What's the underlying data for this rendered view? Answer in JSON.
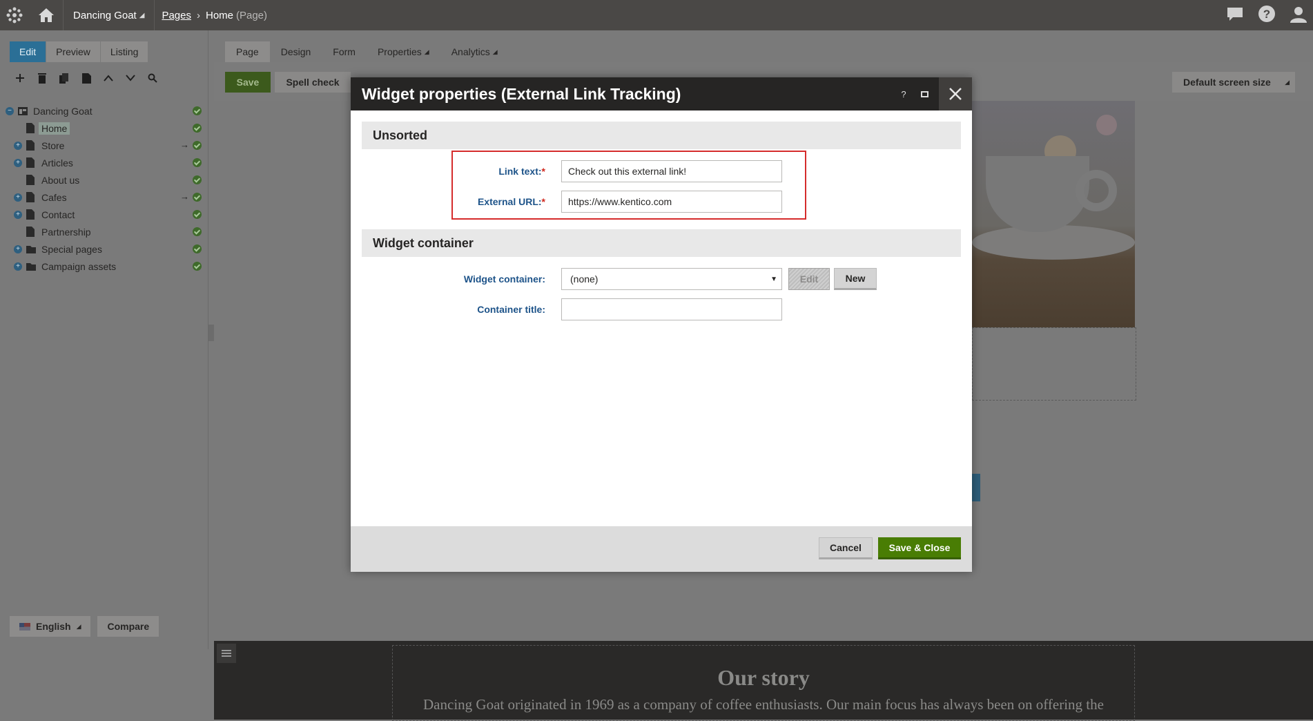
{
  "topbar": {
    "site_name": "Dancing Goat",
    "breadcrumb": {
      "root": "Pages",
      "current": "Home",
      "type": "(Page)"
    },
    "icons": [
      "kentico-logo-icon",
      "home-icon",
      "chat-icon",
      "help-icon",
      "user-icon"
    ]
  },
  "left": {
    "mode_tabs": [
      {
        "label": "Edit",
        "active": true
      },
      {
        "label": "Preview",
        "active": false
      },
      {
        "label": "Listing",
        "active": false
      }
    ],
    "tree": [
      {
        "label": "Dancing Goat",
        "expander": "minus",
        "icon": "site-icon",
        "level": 0,
        "selected": false,
        "arrow": false
      },
      {
        "label": "Home",
        "expander": "",
        "icon": "page-icon",
        "level": 1,
        "selected": true,
        "arrow": false
      },
      {
        "label": "Store",
        "expander": "plus",
        "icon": "page-icon",
        "level": 1,
        "selected": false,
        "arrow": true
      },
      {
        "label": "Articles",
        "expander": "plus",
        "icon": "page-icon",
        "level": 1,
        "selected": false,
        "arrow": false
      },
      {
        "label": "About us",
        "expander": "",
        "icon": "page-icon",
        "level": 1,
        "selected": false,
        "arrow": false
      },
      {
        "label": "Cafes",
        "expander": "plus",
        "icon": "page-icon",
        "level": 1,
        "selected": false,
        "arrow": true
      },
      {
        "label": "Contact",
        "expander": "plus",
        "icon": "page-icon",
        "level": 1,
        "selected": false,
        "arrow": false
      },
      {
        "label": "Partnership",
        "expander": "",
        "icon": "page-icon",
        "level": 1,
        "selected": false,
        "arrow": false
      },
      {
        "label": "Special pages",
        "expander": "plus",
        "icon": "folder-icon",
        "level": 1,
        "selected": false,
        "arrow": false
      },
      {
        "label": "Campaign assets",
        "expander": "plus",
        "icon": "folder-icon",
        "level": 1,
        "selected": false,
        "arrow": false
      }
    ],
    "language": "English",
    "compare": "Compare"
  },
  "content": {
    "tabs": [
      {
        "label": "Page",
        "active": true,
        "caret": false
      },
      {
        "label": "Design",
        "active": false,
        "caret": false
      },
      {
        "label": "Form",
        "active": false,
        "caret": false
      },
      {
        "label": "Properties",
        "active": false,
        "caret": true
      },
      {
        "label": "Analytics",
        "active": false,
        "caret": true
      }
    ],
    "save": "Save",
    "spell_check": "Spell check",
    "screen_size": "Default screen size",
    "story_title": "Our story",
    "story_text": "Dancing Goat originated in 1969 as a company of coffee enthusiasts. Our main focus has always been on offering the"
  },
  "modal": {
    "title": "Widget properties (External Link Tracking)",
    "help": "?",
    "sections": {
      "unsorted": "Unsorted",
      "container": "Widget container"
    },
    "fields": {
      "link_text_label": "Link text:",
      "link_text_value": "Check out this external link!",
      "url_label": "External URL:",
      "url_value": "https://www.kentico.com",
      "required_mark": "*",
      "container_label": "Widget container:",
      "container_value": "(none)",
      "container_title_label": "Container title:",
      "container_title_value": ""
    },
    "buttons": {
      "edit": "Edit",
      "new": "New",
      "cancel": "Cancel",
      "save_close": "Save & Close"
    }
  }
}
